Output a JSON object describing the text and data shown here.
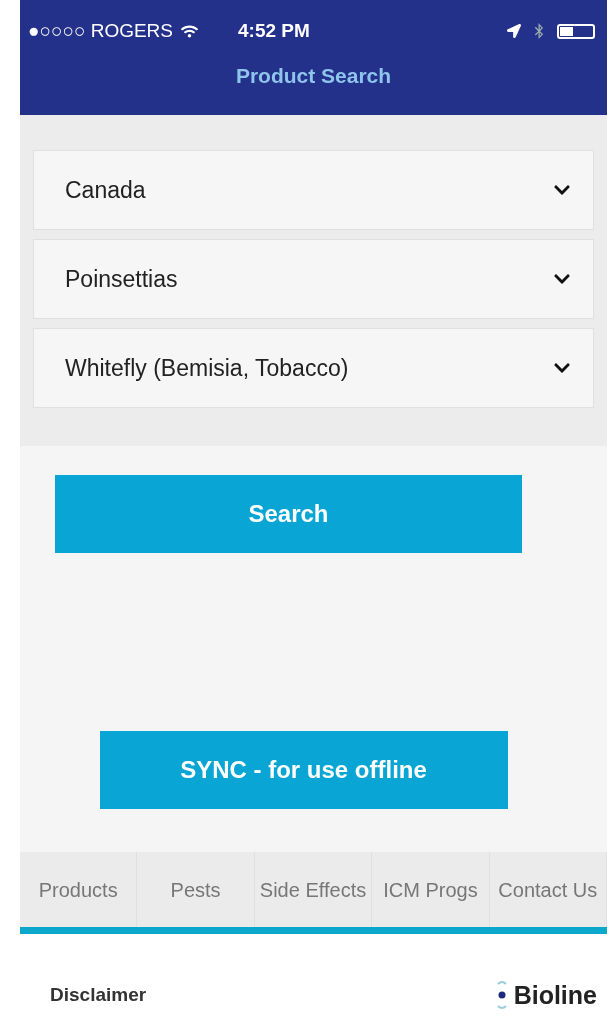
{
  "status_bar": {
    "carrier": "●○○○○ ROGERS",
    "time": "4:52 PM"
  },
  "header": {
    "title": "Product Search"
  },
  "dropdowns": [
    {
      "value": "Canada"
    },
    {
      "value": "Poinsettias"
    },
    {
      "value": "Whitefly (Bemisia, Tobacco)"
    }
  ],
  "search_button": "Search",
  "sync_button": "SYNC - for use offline",
  "tabs": [
    {
      "label": "Products"
    },
    {
      "label": "Pests"
    },
    {
      "label": "Side Effects"
    },
    {
      "label": "ICM Progs"
    },
    {
      "label": "Contact Us"
    }
  ],
  "footer": {
    "disclaimer": "Disclaimer",
    "logo": "Bioline"
  }
}
